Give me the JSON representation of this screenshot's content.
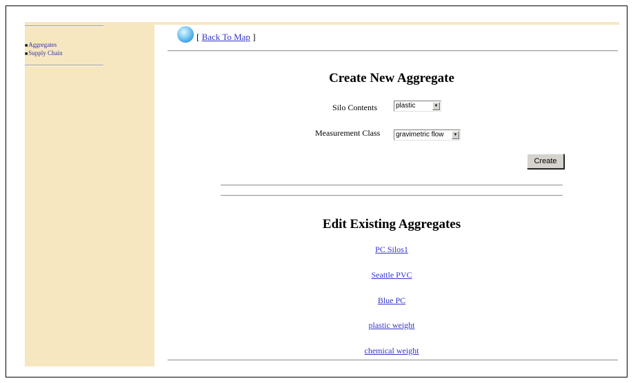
{
  "sidebar": {
    "items": [
      {
        "label": "Aggregates"
      },
      {
        "label": "Supply Chain"
      }
    ],
    "bullet": "■"
  },
  "header": {
    "back_link": {
      "prefix": "[",
      "label": "Back To Map",
      "suffix": "]"
    },
    "icon": "globe-icon"
  },
  "create_section": {
    "title": "Create New Aggregate",
    "silo_contents": {
      "label": "Silo Contents",
      "value": "plastic"
    },
    "measurement_class": {
      "label": "Measurement Class",
      "value": "gravimetric flow"
    },
    "create_button": "Create"
  },
  "edit_section": {
    "title": "Edit Existing Aggregates",
    "links": [
      "PC Silos1",
      "Seattle PVC",
      "Blue PC",
      "plastic weight",
      "chemical weight"
    ]
  },
  "colors": {
    "sidebar_bg": "#f6e7c1",
    "link": "#3333cc"
  }
}
